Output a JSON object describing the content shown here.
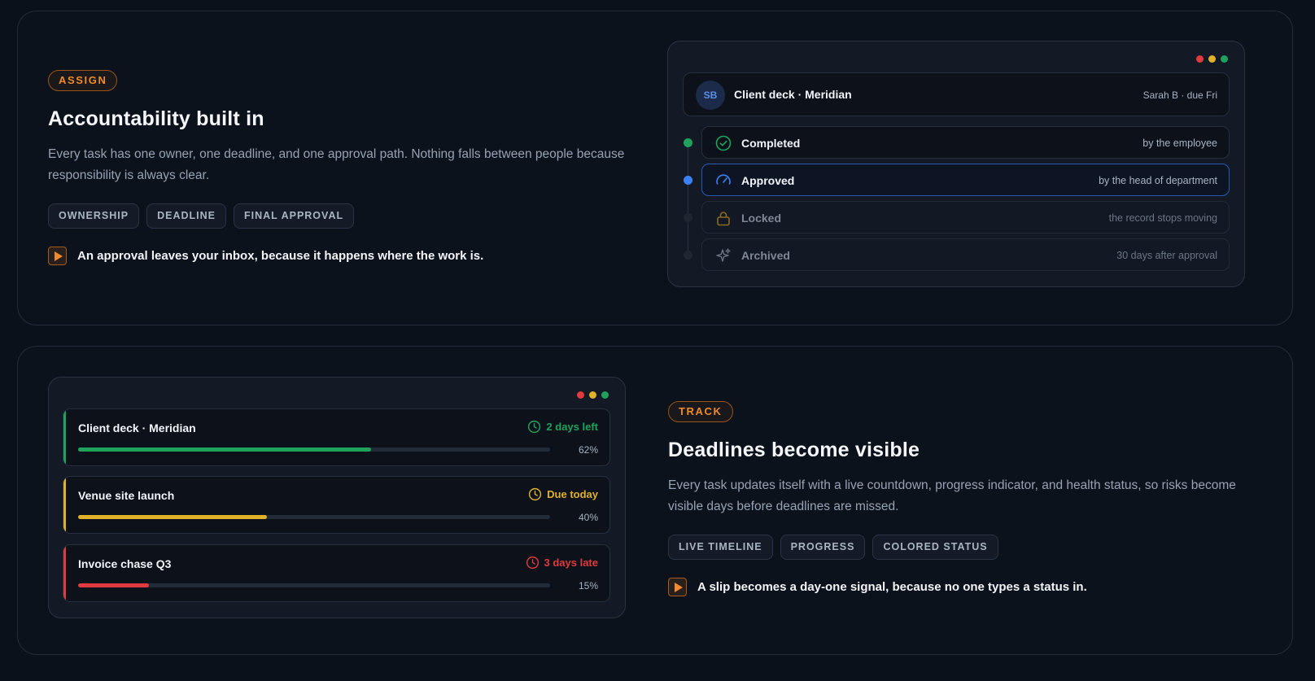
{
  "assign": {
    "pill": "ASSIGN",
    "heading": "Accountability built in",
    "description": "Every task has one owner, one deadline, and one approval path. Nothing falls between people because responsibility is always clear.",
    "chips": [
      "OWNERSHIP",
      "DEADLINE",
      "FINAL APPROVAL"
    ],
    "callout": "An approval leaves your inbox, because it happens where the work is.",
    "card": {
      "avatar": "SB",
      "title": "Client deck · Meridian",
      "meta": "Sarah B · due Fri"
    },
    "steps": [
      {
        "label": "Completed",
        "note": "by the employee",
        "icon": "check-circle-icon",
        "color": "#1fa35c"
      },
      {
        "label": "Approved",
        "note": "by the head of department",
        "icon": "gauge-icon",
        "color": "#3b82f6"
      },
      {
        "label": "Locked",
        "note": "the record stops moving",
        "icon": "lock-icon",
        "color": "#8a6a1e"
      },
      {
        "label": "Archived",
        "note": "30 days after approval",
        "icon": "sparkle-icon",
        "color": "#6b7583"
      }
    ]
  },
  "track": {
    "pill": "TRACK",
    "heading": "Deadlines become visible",
    "description": "Every task updates itself with a live countdown, progress indicator, and health status, so risks become visible days before deadlines are missed.",
    "chips": [
      "LIVE TIMELINE",
      "PROGRESS",
      "COLORED STATUS"
    ],
    "callout": "A slip becomes a day-one signal, because no one types a status in.",
    "tasks": [
      {
        "title": "Client deck · Meridian",
        "status": "2 days left",
        "progress": 62,
        "progress_label": "62%",
        "color": "#1fa35c"
      },
      {
        "title": "Venue site launch",
        "status": "Due today",
        "progress": 40,
        "progress_label": "40%",
        "color": "#e0b22a"
      },
      {
        "title": "Invoice chase Q3",
        "status": "3 days late",
        "progress": 15,
        "progress_label": "15%",
        "color": "#e0393e"
      }
    ]
  }
}
